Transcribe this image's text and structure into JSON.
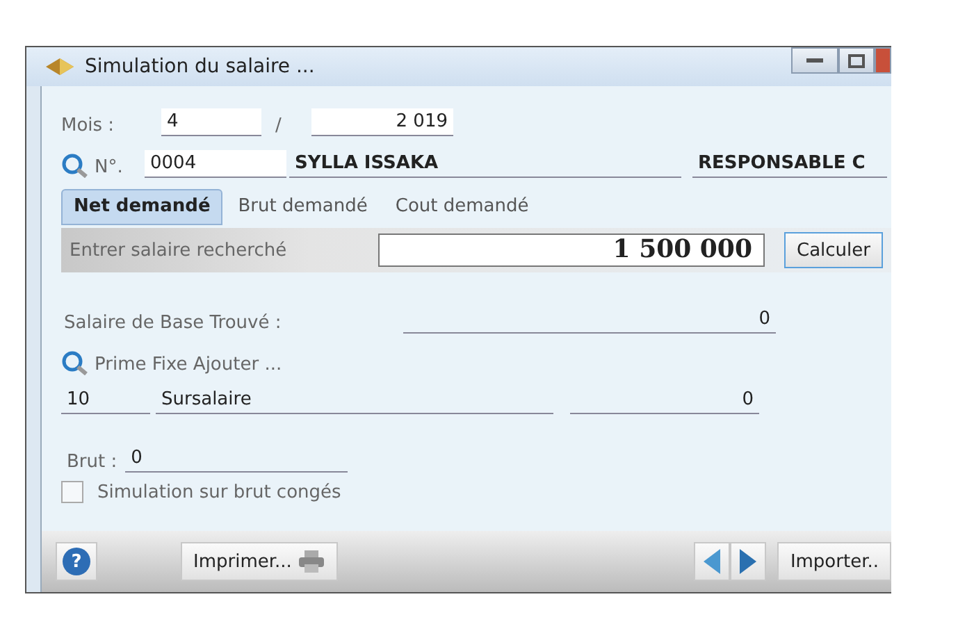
{
  "window": {
    "title": "Simulation du salaire ..."
  },
  "period": {
    "label": "Mois :",
    "month": "4",
    "separator": "/",
    "year": "2 019"
  },
  "employee": {
    "number_label": "N°.",
    "number": "0004",
    "name": "SYLLA ISSAKA",
    "position": "RESPONSABLE C"
  },
  "tabs": [
    {
      "label": "Net demandé",
      "selected": true
    },
    {
      "label": "Brut demandé",
      "selected": false
    },
    {
      "label": "Cout demandé",
      "selected": false
    }
  ],
  "search": {
    "label": "Entrer salaire recherché",
    "value": "1 500 000",
    "button": "Calculer"
  },
  "base_salary": {
    "label": "Salaire de Base Trouvé :",
    "value": "0"
  },
  "bonus": {
    "label": "Prime Fixe Ajouter ...",
    "code": "10",
    "name": "Sursalaire",
    "amount": "0"
  },
  "gross": {
    "label": "Brut :",
    "value": "0"
  },
  "leave_simulation": {
    "label": "Simulation sur brut congés",
    "checked": false
  },
  "footer": {
    "help": "?",
    "print": "Imprimer...",
    "import": "Importer.."
  }
}
